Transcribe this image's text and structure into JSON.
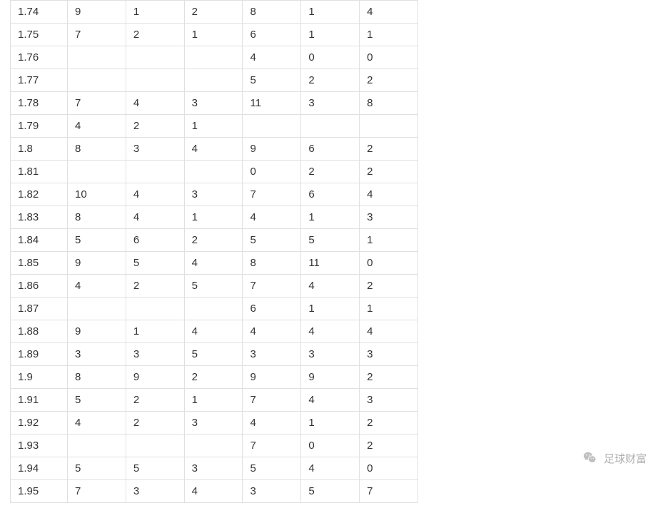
{
  "watermark": {
    "label": "足球财富"
  },
  "table": {
    "rows": [
      {
        "c0": "1.74",
        "c1": "9",
        "c2": "1",
        "c3": "2",
        "c4": "8",
        "c5": "1",
        "c6": "4"
      },
      {
        "c0": "1.75",
        "c1": "7",
        "c2": "2",
        "c3": "1",
        "c4": "6",
        "c5": "1",
        "c6": "1"
      },
      {
        "c0": "1.76",
        "c1": "",
        "c2": "",
        "c3": "",
        "c4": "4",
        "c5": "0",
        "c6": "0"
      },
      {
        "c0": "1.77",
        "c1": "",
        "c2": "",
        "c3": "",
        "c4": "5",
        "c5": "2",
        "c6": "2"
      },
      {
        "c0": "1.78",
        "c1": "7",
        "c2": "4",
        "c3": "3",
        "c4": "11",
        "c5": "3",
        "c6": "8"
      },
      {
        "c0": "1.79",
        "c1": "4",
        "c2": "2",
        "c3": "1",
        "c4": "",
        "c5": "",
        "c6": ""
      },
      {
        "c0": "1.8",
        "c1": "8",
        "c2": "3",
        "c3": "4",
        "c4": "9",
        "c5": "6",
        "c6": "2"
      },
      {
        "c0": "1.81",
        "c1": "",
        "c2": "",
        "c3": "",
        "c4": "0",
        "c5": "2",
        "c6": "2"
      },
      {
        "c0": "1.82",
        "c1": "10",
        "c2": "4",
        "c3": "3",
        "c4": "7",
        "c5": "6",
        "c6": "4"
      },
      {
        "c0": "1.83",
        "c1": "8",
        "c2": "4",
        "c3": "1",
        "c4": "4",
        "c5": "1",
        "c6": "3"
      },
      {
        "c0": "1.84",
        "c1": "5",
        "c2": "6",
        "c3": "2",
        "c4": "5",
        "c5": "5",
        "c6": "1"
      },
      {
        "c0": "1.85",
        "c1": "9",
        "c2": "5",
        "c3": "4",
        "c4": "8",
        "c5": "11",
        "c6": "0"
      },
      {
        "c0": "1.86",
        "c1": "4",
        "c2": "2",
        "c3": "5",
        "c4": "7",
        "c5": "4",
        "c6": "2"
      },
      {
        "c0": "1.87",
        "c1": "",
        "c2": "",
        "c3": "",
        "c4": "6",
        "c5": "1",
        "c6": "1"
      },
      {
        "c0": "1.88",
        "c1": "9",
        "c2": "1",
        "c3": "4",
        "c4": "4",
        "c5": "4",
        "c6": "4"
      },
      {
        "c0": "1.89",
        "c1": "3",
        "c2": "3",
        "c3": "5",
        "c4": "3",
        "c5": "3",
        "c6": "3"
      },
      {
        "c0": "1.9",
        "c1": "8",
        "c2": "9",
        "c3": "2",
        "c4": "9",
        "c5": "9",
        "c6": "2"
      },
      {
        "c0": "1.91",
        "c1": "5",
        "c2": "2",
        "c3": "1",
        "c4": "7",
        "c5": "4",
        "c6": "3"
      },
      {
        "c0": "1.92",
        "c1": "4",
        "c2": "2",
        "c3": "3",
        "c4": "4",
        "c5": "1",
        "c6": "2"
      },
      {
        "c0": "1.93",
        "c1": "",
        "c2": "",
        "c3": "",
        "c4": "7",
        "c5": "0",
        "c6": "2"
      },
      {
        "c0": "1.94",
        "c1": "5",
        "c2": "5",
        "c3": "3",
        "c4": "5",
        "c5": "4",
        "c6": "0"
      },
      {
        "c0": "1.95",
        "c1": "7",
        "c2": "3",
        "c3": "4",
        "c4": "3",
        "c5": "5",
        "c6": "7"
      }
    ]
  }
}
